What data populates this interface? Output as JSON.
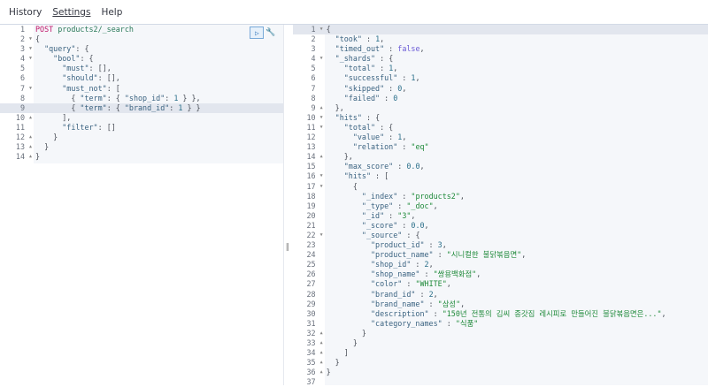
{
  "menu": {
    "items": [
      "History",
      "Settings",
      "Help"
    ]
  },
  "icons": {
    "run": "play-icon",
    "settings": "wrench-icon",
    "divider": "drag-handle-icon"
  },
  "request": {
    "active_line": 9,
    "lines": [
      [
        [
          "m",
          "POST"
        ],
        [
          "p",
          " "
        ],
        [
          "u",
          "products2/_search"
        ]
      ],
      [
        [
          "p",
          "{"
        ]
      ],
      [
        [
          "p",
          "  "
        ],
        [
          "k",
          "\"query\""
        ],
        [
          "p",
          ": {"
        ]
      ],
      [
        [
          "p",
          "    "
        ],
        [
          "k",
          "\"bool\""
        ],
        [
          "p",
          ": {"
        ]
      ],
      [
        [
          "p",
          "      "
        ],
        [
          "k",
          "\"must\""
        ],
        [
          "p",
          ": [],"
        ]
      ],
      [
        [
          "p",
          "      "
        ],
        [
          "k",
          "\"should\""
        ],
        [
          "p",
          ": [],"
        ]
      ],
      [
        [
          "p",
          "      "
        ],
        [
          "k",
          "\"must_not\""
        ],
        [
          "p",
          ": ["
        ]
      ],
      [
        [
          "p",
          "        { "
        ],
        [
          "k",
          "\"term\""
        ],
        [
          "p",
          ": { "
        ],
        [
          "k",
          "\"shop_id\""
        ],
        [
          "p",
          ": "
        ],
        [
          "n",
          "1"
        ],
        [
          "p",
          " } },"
        ]
      ],
      [
        [
          "p",
          "        { "
        ],
        [
          "k",
          "\"term\""
        ],
        [
          "p",
          ": { "
        ],
        [
          "k",
          "\"brand_id\""
        ],
        [
          "p",
          ": "
        ],
        [
          "n",
          "1"
        ],
        [
          "p",
          " } }"
        ]
      ],
      [
        [
          "p",
          "      ],"
        ]
      ],
      [
        [
          "p",
          "      "
        ],
        [
          "k",
          "\"filter\""
        ],
        [
          "p",
          ": []"
        ]
      ],
      [
        [
          "p",
          "    }"
        ]
      ],
      [
        [
          "p",
          "  }"
        ]
      ],
      [
        [
          "p",
          "}"
        ]
      ]
    ],
    "folds": {
      "2": "down",
      "3": "down",
      "4": "down",
      "7": "down",
      "10": "up",
      "12": "up",
      "13": "up",
      "14": "up"
    }
  },
  "response": {
    "active_line": 1,
    "lines": [
      [
        [
          "p",
          "{"
        ]
      ],
      [
        [
          "p",
          "  "
        ],
        [
          "k",
          "\"took\""
        ],
        [
          "p",
          " : "
        ],
        [
          "n",
          "1"
        ],
        [
          "p",
          ","
        ]
      ],
      [
        [
          "p",
          "  "
        ],
        [
          "k",
          "\"timed_out\""
        ],
        [
          "p",
          " : "
        ],
        [
          "b",
          "false"
        ],
        [
          "p",
          ","
        ]
      ],
      [
        [
          "p",
          "  "
        ],
        [
          "k",
          "\"_shards\""
        ],
        [
          "p",
          " : {"
        ]
      ],
      [
        [
          "p",
          "    "
        ],
        [
          "k",
          "\"total\""
        ],
        [
          "p",
          " : "
        ],
        [
          "n",
          "1"
        ],
        [
          "p",
          ","
        ]
      ],
      [
        [
          "p",
          "    "
        ],
        [
          "k",
          "\"successful\""
        ],
        [
          "p",
          " : "
        ],
        [
          "n",
          "1"
        ],
        [
          "p",
          ","
        ]
      ],
      [
        [
          "p",
          "    "
        ],
        [
          "k",
          "\"skipped\""
        ],
        [
          "p",
          " : "
        ],
        [
          "n",
          "0"
        ],
        [
          "p",
          ","
        ]
      ],
      [
        [
          "p",
          "    "
        ],
        [
          "k",
          "\"failed\""
        ],
        [
          "p",
          " : "
        ],
        [
          "n",
          "0"
        ]
      ],
      [
        [
          "p",
          "  },"
        ]
      ],
      [
        [
          "p",
          "  "
        ],
        [
          "k",
          "\"hits\""
        ],
        [
          "p",
          " : {"
        ]
      ],
      [
        [
          "p",
          "    "
        ],
        [
          "k",
          "\"total\""
        ],
        [
          "p",
          " : {"
        ]
      ],
      [
        [
          "p",
          "      "
        ],
        [
          "k",
          "\"value\""
        ],
        [
          "p",
          " : "
        ],
        [
          "n",
          "1"
        ],
        [
          "p",
          ","
        ]
      ],
      [
        [
          "p",
          "      "
        ],
        [
          "k",
          "\"relation\""
        ],
        [
          "p",
          " : "
        ],
        [
          "s",
          "\"eq\""
        ]
      ],
      [
        [
          "p",
          "    },"
        ]
      ],
      [
        [
          "p",
          "    "
        ],
        [
          "k",
          "\"max_score\""
        ],
        [
          "p",
          " : "
        ],
        [
          "n",
          "0.0"
        ],
        [
          "p",
          ","
        ]
      ],
      [
        [
          "p",
          "    "
        ],
        [
          "k",
          "\"hits\""
        ],
        [
          "p",
          " : ["
        ]
      ],
      [
        [
          "p",
          "      {"
        ]
      ],
      [
        [
          "p",
          "        "
        ],
        [
          "k",
          "\"_index\""
        ],
        [
          "p",
          " : "
        ],
        [
          "s",
          "\"products2\""
        ],
        [
          "p",
          ","
        ]
      ],
      [
        [
          "p",
          "        "
        ],
        [
          "k",
          "\"_type\""
        ],
        [
          "p",
          " : "
        ],
        [
          "s",
          "\"_doc\""
        ],
        [
          "p",
          ","
        ]
      ],
      [
        [
          "p",
          "        "
        ],
        [
          "k",
          "\"_id\""
        ],
        [
          "p",
          " : "
        ],
        [
          "s",
          "\"3\""
        ],
        [
          "p",
          ","
        ]
      ],
      [
        [
          "p",
          "        "
        ],
        [
          "k",
          "\"_score\""
        ],
        [
          "p",
          " : "
        ],
        [
          "n",
          "0.0"
        ],
        [
          "p",
          ","
        ]
      ],
      [
        [
          "p",
          "        "
        ],
        [
          "k",
          "\"_source\""
        ],
        [
          "p",
          " : {"
        ]
      ],
      [
        [
          "p",
          "          "
        ],
        [
          "k",
          "\"product_id\""
        ],
        [
          "p",
          " : "
        ],
        [
          "n",
          "3"
        ],
        [
          "p",
          ","
        ]
      ],
      [
        [
          "p",
          "          "
        ],
        [
          "k",
          "\"product_name\""
        ],
        [
          "p",
          " : "
        ],
        [
          "s",
          "\"시니컬한 불닭볶음면\""
        ],
        [
          "p",
          ","
        ]
      ],
      [
        [
          "p",
          "          "
        ],
        [
          "k",
          "\"shop_id\""
        ],
        [
          "p",
          " : "
        ],
        [
          "n",
          "2"
        ],
        [
          "p",
          ","
        ]
      ],
      [
        [
          "p",
          "          "
        ],
        [
          "k",
          "\"shop_name\""
        ],
        [
          "p",
          " : "
        ],
        [
          "s",
          "\"쌍용백화점\""
        ],
        [
          "p",
          ","
        ]
      ],
      [
        [
          "p",
          "          "
        ],
        [
          "k",
          "\"color\""
        ],
        [
          "p",
          " : "
        ],
        [
          "s",
          "\"WHITE\""
        ],
        [
          "p",
          ","
        ]
      ],
      [
        [
          "p",
          "          "
        ],
        [
          "k",
          "\"brand_id\""
        ],
        [
          "p",
          " : "
        ],
        [
          "n",
          "2"
        ],
        [
          "p",
          ","
        ]
      ],
      [
        [
          "p",
          "          "
        ],
        [
          "k",
          "\"brand_name\""
        ],
        [
          "p",
          " : "
        ],
        [
          "s",
          "\"삼성\""
        ],
        [
          "p",
          ","
        ]
      ],
      [
        [
          "p",
          "          "
        ],
        [
          "k",
          "\"description\""
        ],
        [
          "p",
          " : "
        ],
        [
          "s",
          "\"150년 전통의 김씨 종갓집 레시피로 만들어진 불닭볶음면은...\""
        ],
        [
          "p",
          ","
        ]
      ],
      [
        [
          "p",
          "          "
        ],
        [
          "k",
          "\"category_names\""
        ],
        [
          "p",
          " : "
        ],
        [
          "s",
          "\"식품\""
        ]
      ],
      [
        [
          "p",
          "        }"
        ]
      ],
      [
        [
          "p",
          "      }"
        ]
      ],
      [
        [
          "p",
          "    ]"
        ]
      ],
      [
        [
          "p",
          "  }"
        ]
      ],
      [
        [
          "p",
          "}"
        ]
      ],
      []
    ],
    "folds": {
      "1": "down",
      "4": "down",
      "9": "up",
      "10": "down",
      "11": "down",
      "14": "up",
      "16": "down",
      "17": "down",
      "22": "down",
      "32": "up",
      "33": "up",
      "34": "up",
      "35": "up",
      "36": "up"
    }
  }
}
